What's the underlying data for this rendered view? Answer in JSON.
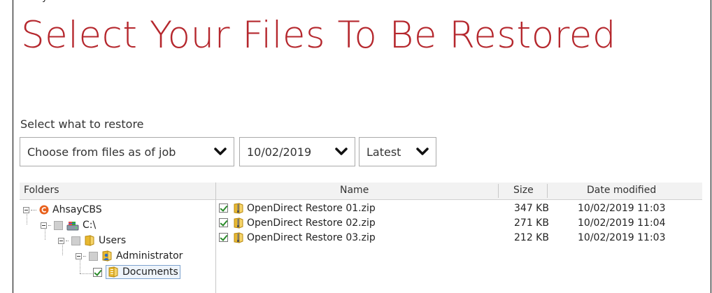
{
  "page": {
    "title": "Select Your Files To Be Restored",
    "top_fragment": "y"
  },
  "restore": {
    "subtitle": "Select what to restore",
    "mode_dropdown": "Choose from files as of job",
    "date_dropdown": "10/02/2019",
    "version_dropdown": "Latest"
  },
  "browser": {
    "headers": {
      "folders": "Folders",
      "name": "Name",
      "size": "Size",
      "date": "Date modified"
    },
    "tree": [
      {
        "label": "AhsayCBS",
        "icon": "ahsay-logo-icon",
        "checkbox": "none"
      },
      {
        "label": "C:\\",
        "icon": "drive-icon",
        "checkbox": "partial"
      },
      {
        "label": "Users",
        "icon": "folder-icon",
        "checkbox": "partial"
      },
      {
        "label": "Administrator",
        "icon": "user-folder-icon",
        "checkbox": "partial"
      },
      {
        "label": "Documents",
        "icon": "documents-folder-icon",
        "checkbox": "checked"
      }
    ],
    "files": [
      {
        "name": "OpenDirect Restore 01.zip",
        "size": "347 KB",
        "date": "10/02/2019 11:03",
        "checked": true,
        "icon": "zip-file-icon"
      },
      {
        "name": "OpenDirect Restore 02.zip",
        "size": "271 KB",
        "date": "10/02/2019 11:04",
        "checked": true,
        "icon": "zip-file-icon"
      },
      {
        "name": "OpenDirect Restore 03.zip",
        "size": "212 KB",
        "date": "10/02/2019 11:03",
        "checked": true,
        "icon": "zip-file-icon"
      }
    ]
  },
  "colors": {
    "accent": "#b5272d",
    "checkmark": "#2a8a2a",
    "folder": "#e8b830"
  }
}
